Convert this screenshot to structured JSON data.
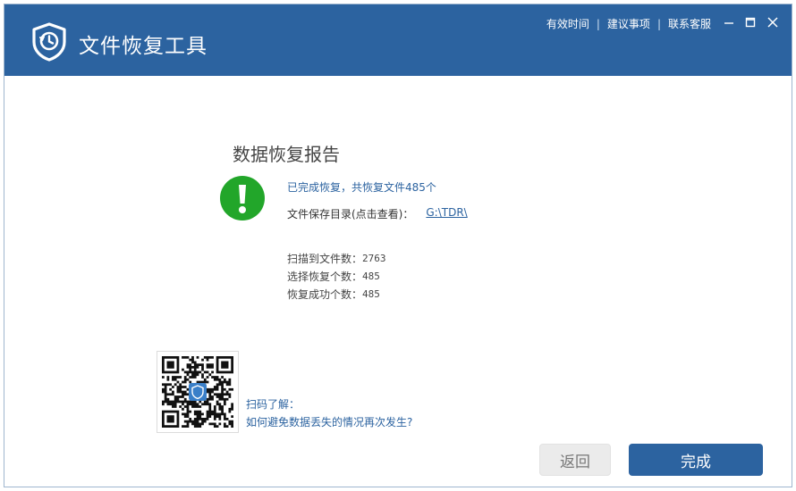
{
  "app": {
    "title": "文件恢复工具"
  },
  "header": {
    "links": [
      "有效时间",
      "建议事项",
      "联系客服"
    ],
    "accent_color": "#2c63a0"
  },
  "report": {
    "title": "数据恢复报告",
    "status_icon": "exclamation-icon",
    "status_color": "#22a62a",
    "status_text": "已完成恢复，共恢复文件485个",
    "dir_label": "文件保存目录(点击查看)：",
    "dir_path": "G:\\TDR\\",
    "stats": [
      {
        "label": "扫描到文件数：",
        "value": "2763"
      },
      {
        "label": "选择恢复个数：",
        "value": "485"
      },
      {
        "label": "恢复成功个数：",
        "value": "485"
      }
    ]
  },
  "qr": {
    "caption_line1": "扫码了解：",
    "caption_line2": "如何避免数据丢失的情况再次发生?"
  },
  "buttons": {
    "back": "返回",
    "done": "完成"
  }
}
